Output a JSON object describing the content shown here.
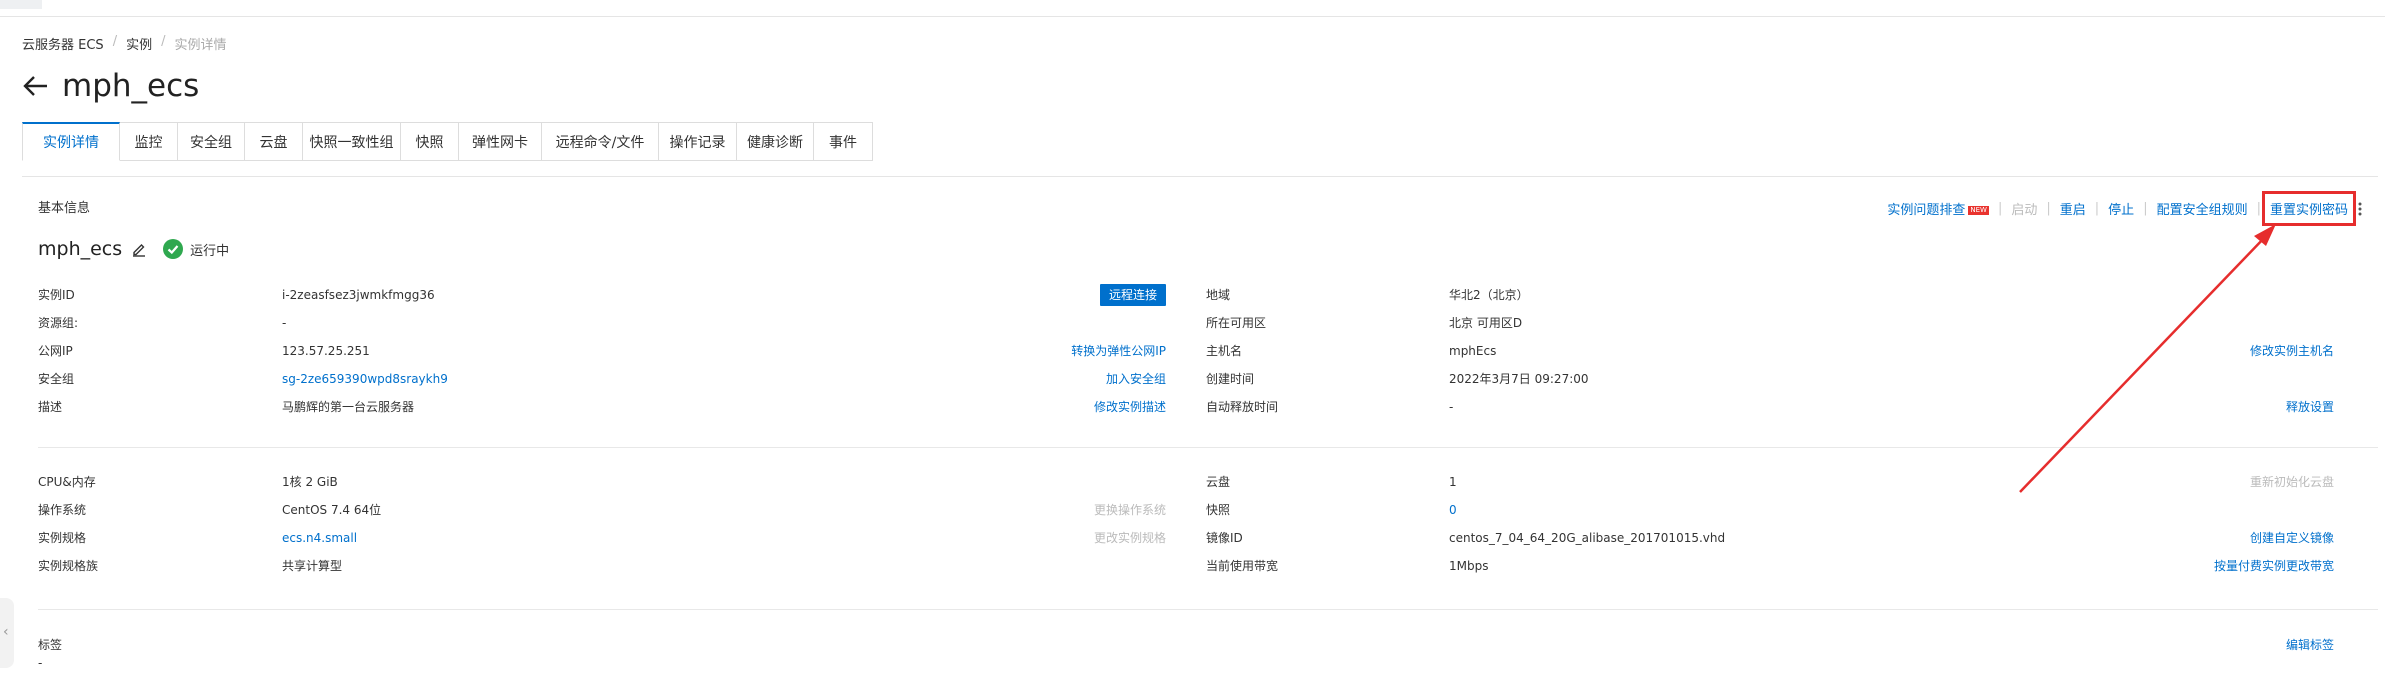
{
  "breadcrumb": {
    "item1": "云服务器 ECS",
    "item2": "实例",
    "item3": "实例详情",
    "sep": "/"
  },
  "header": {
    "title": "mph_ecs",
    "back_icon": "arrow-left-icon"
  },
  "tabs": [
    {
      "label": "实例详情",
      "active": true
    },
    {
      "label": "监控"
    },
    {
      "label": "安全组"
    },
    {
      "label": "云盘"
    },
    {
      "label": "快照一致性组"
    },
    {
      "label": "快照"
    },
    {
      "label": "弹性网卡"
    },
    {
      "label": "远程命令/文件"
    },
    {
      "label": "操作记录"
    },
    {
      "label": "健康诊断"
    },
    {
      "label": "事件"
    }
  ],
  "basic_info": {
    "title": "基本信息",
    "actions": {
      "troubleshoot": "实例问题排查",
      "new_badge": "NEW",
      "start": "启动",
      "restart": "重启",
      "stop": "停止",
      "config_sg_rules": "配置安全组规则",
      "reset_password": "重置实例密码"
    },
    "instance_name": "mph_ecs",
    "status": "运行中",
    "status_color": "#2fa84f",
    "accent_color": "#0070cc",
    "highlight_color": "#e62d2d"
  },
  "section1": {
    "instance_id_label": "实例ID",
    "instance_id": "i-2zeasfsez3jwmkfmgg36",
    "remote_connect": "远程连接",
    "resource_group_label": "资源组:",
    "resource_group": "-",
    "public_ip_label": "公网IP",
    "public_ip": "123.57.25.251",
    "convert_eip": "转换为弹性公网IP",
    "security_group_label": "安全组",
    "security_group": "sg-2ze659390wpd8sraykh9",
    "join_sg": "加入安全组",
    "description_label": "描述",
    "description": "马鹏辉的第一台云服务器",
    "edit_desc": "修改实例描述",
    "region_label": "地域",
    "region": "华北2（北京）",
    "zone_label": "所在可用区",
    "zone": "北京 可用区D",
    "hostname_label": "主机名",
    "hostname": "mphEcs",
    "edit_hostname": "修改实例主机名",
    "created_label": "创建时间",
    "created": "2022年3月7日 09:27:00",
    "auto_release_label": "自动释放时间",
    "auto_release": "-",
    "release_settings": "释放设置"
  },
  "section2": {
    "cpu_label": "CPU&内存",
    "cpu": "1核 2 GiB",
    "os_label": "操作系统",
    "os": "CentOS 7.4 64位",
    "change_os": "更换操作系统",
    "spec_label": "实例规格",
    "spec": "ecs.n4.small",
    "change_spec": "更改实例规格",
    "family_label": "实例规格族",
    "family": "共享计算型",
    "disk_label": "云盘",
    "disk": "1",
    "reinit_disk": "重新初始化云盘",
    "snapshot_label": "快照",
    "snapshot": "0",
    "image_label": "镜像ID",
    "image": "centos_7_04_64_20G_alibase_201701015.vhd",
    "create_image": "创建自定义镜像",
    "bandwidth_label": "当前使用带宽",
    "bandwidth": "1Mbps",
    "change_bandwidth": "按量付费实例更改带宽"
  },
  "section3": {
    "tags_label": "标签",
    "tags": "-",
    "edit_tags": "编辑标签"
  }
}
